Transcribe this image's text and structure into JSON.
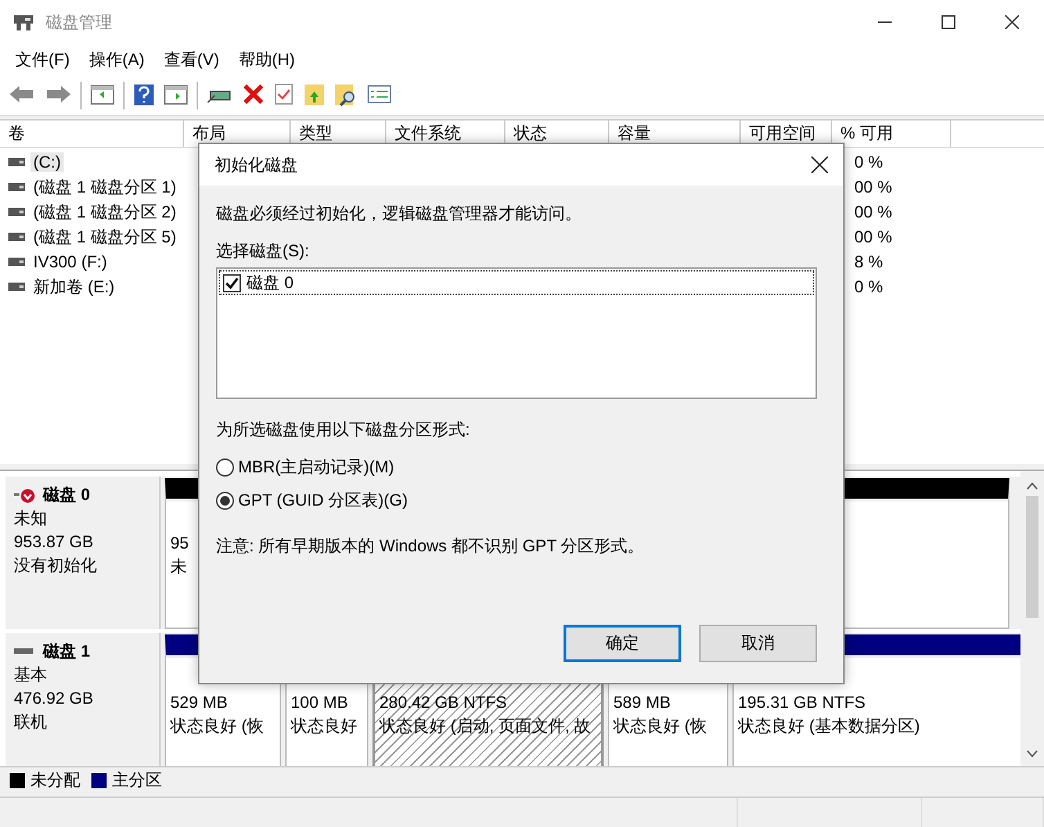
{
  "window": {
    "title": "磁盘管理"
  },
  "menu": [
    {
      "label": "文件(F)"
    },
    {
      "label": "操作(A)"
    },
    {
      "label": "查看(V)"
    },
    {
      "label": "帮助(H)"
    }
  ],
  "volume_table": {
    "columns": [
      "卷",
      "布局",
      "类型",
      "文件系统",
      "状态",
      "容量",
      "可用空间",
      "% 可用"
    ],
    "rows": [
      {
        "volume": "(C:)",
        "selected": true,
        "percent_free": "0 %"
      },
      {
        "volume": "(磁盘 1 磁盘分区 1)",
        "selected": false,
        "percent_free": "00 %"
      },
      {
        "volume": "(磁盘 1 磁盘分区 2)",
        "selected": false,
        "percent_free": "00 %"
      },
      {
        "volume": "(磁盘 1 磁盘分区 5)",
        "selected": false,
        "percent_free": "00 %"
      },
      {
        "volume": "IV300 (F:)",
        "selected": false,
        "percent_free": "8 %"
      },
      {
        "volume": "新加卷 (E:)",
        "selected": false,
        "percent_free": "0 %"
      }
    ]
  },
  "disks": [
    {
      "name": "磁盘 0",
      "kind": "uninitialized",
      "lines": [
        "未知",
        "953.87 GB",
        "没有初始化"
      ],
      "partitions": [
        {
          "kind": "unallocated",
          "selected": false,
          "lines": [
            "95",
            "未"
          ]
        }
      ]
    },
    {
      "name": "磁盘 1",
      "kind": "basic",
      "lines": [
        "基本",
        "476.92 GB",
        "联机"
      ],
      "partitions": [
        {
          "kind": "primary",
          "selected": false,
          "lines": [
            "529 MB",
            "状态良好 (恢"
          ]
        },
        {
          "kind": "primary",
          "selected": false,
          "lines": [
            "100 MB",
            "状态良好"
          ]
        },
        {
          "kind": "primary",
          "selected": true,
          "lines": [
            "280.42 GB NTFS",
            "状态良好 (启动, 页面文件, 故"
          ]
        },
        {
          "kind": "primary",
          "selected": false,
          "lines": [
            "589 MB",
            "状态良好 (恢"
          ]
        },
        {
          "kind": "primary",
          "selected": false,
          "lines": [
            "195.31 GB NTFS",
            "状态良好 (基本数据分区)"
          ]
        }
      ]
    }
  ],
  "legend": [
    {
      "label": "未分配",
      "color": "#000000"
    },
    {
      "label": "主分区",
      "color": "#000080"
    }
  ],
  "dialog": {
    "title": "初始化磁盘",
    "message": "磁盘必须经过初始化，逻辑磁盘管理器才能访问。",
    "select_label": "选择磁盘(S):",
    "disks": [
      {
        "label": "磁盘 0",
        "checked": true
      }
    ],
    "style_label": "为所选磁盘使用以下磁盘分区形式:",
    "partition_styles": [
      {
        "label": "MBR(主启动记录)(M)",
        "selected": false
      },
      {
        "label": "GPT (GUID 分区表)(G)",
        "selected": true
      }
    ],
    "note": "注意: 所有早期版本的 Windows 都不识别 GPT 分区形式。",
    "buttons": [
      {
        "label": "确定",
        "default": true
      },
      {
        "label": "取消",
        "default": false
      }
    ]
  }
}
